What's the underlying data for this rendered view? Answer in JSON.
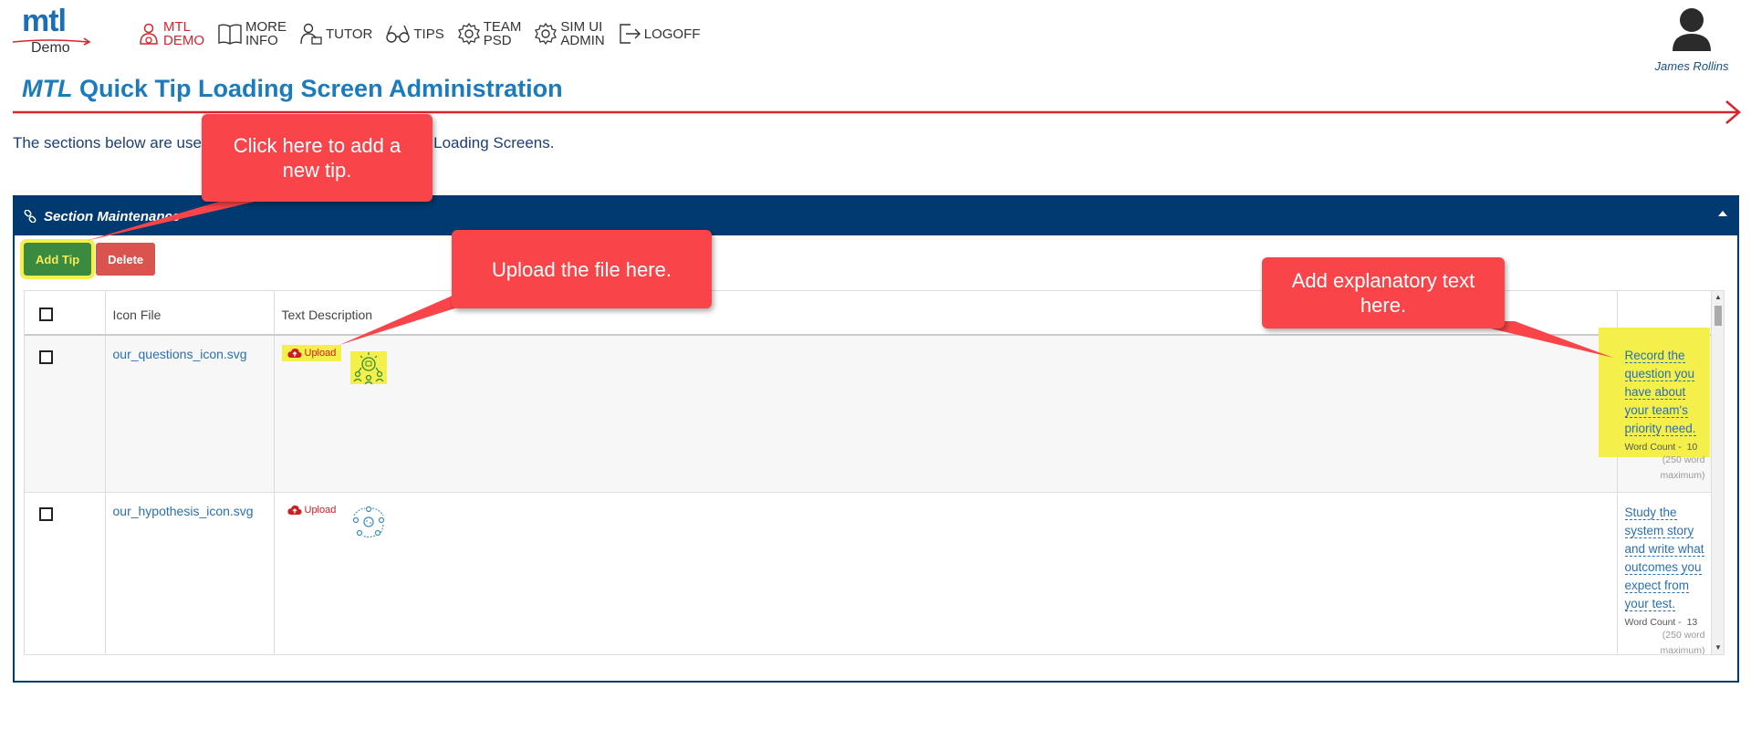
{
  "logo": {
    "brand": "mtl",
    "subtitle": "Demo"
  },
  "nav": [
    {
      "line1": "MTL",
      "line2": "DEMO",
      "icon": "person-demo-icon",
      "active": true
    },
    {
      "line1": "MORE",
      "line2": "INFO",
      "icon": "book-icon",
      "active": false
    },
    {
      "line1": "TUTOR",
      "line2": "",
      "icon": "tutor-icon",
      "active": false
    },
    {
      "line1": "TIPS",
      "line2": "",
      "icon": "glasses-icon",
      "active": false
    },
    {
      "line1": "TEAM",
      "line2": "PSD",
      "icon": "gear-icon",
      "active": false
    },
    {
      "line1": "SIM UI",
      "line2": "ADMIN",
      "icon": "gear-icon",
      "active": false
    },
    {
      "line1": "LOGOFF",
      "line2": "",
      "icon": "logout-icon",
      "active": false
    }
  ],
  "user": {
    "name": "James Rollins",
    "icon": "user-avatar-icon"
  },
  "page": {
    "title_prefix": "MTL",
    "title_rest": "Quick Tip Loading Screen Administration",
    "intro": "The sections below are used to add, delete, or edit Quick Tip Loading Screens."
  },
  "panel": {
    "title": "Section Maintenance",
    "add_label": "Add Tip",
    "delete_label": "Delete",
    "columns": [
      "",
      "Icon File",
      "Text Description",
      ""
    ],
    "rows": [
      {
        "icon_file": "our_questions_icon.svg",
        "upload_label": "Upload",
        "description": "Record the question you have about your team's priority need.",
        "word_count_label": "Word Count -",
        "word_count": "10",
        "word_max": "(250 word maximum)"
      },
      {
        "icon_file": "our_hypothesis_icon.svg",
        "upload_label": "Upload",
        "description": "Study the system story and write what outcomes you expect from your test.",
        "word_count_label": "Word Count -",
        "word_count": "13",
        "word_max": "(250 word maximum)"
      }
    ]
  },
  "callouts": {
    "add_tip": "Click here to add a new tip.",
    "upload": "Upload the file here.",
    "text": "Add explanatory text here."
  },
  "colors": {
    "brand_blue": "#1a7bbd",
    "panel_navy": "#003a70",
    "callout_red": "#f9444a",
    "highlight_yellow": "#f4ef4a",
    "rule_red": "#d8232a"
  }
}
